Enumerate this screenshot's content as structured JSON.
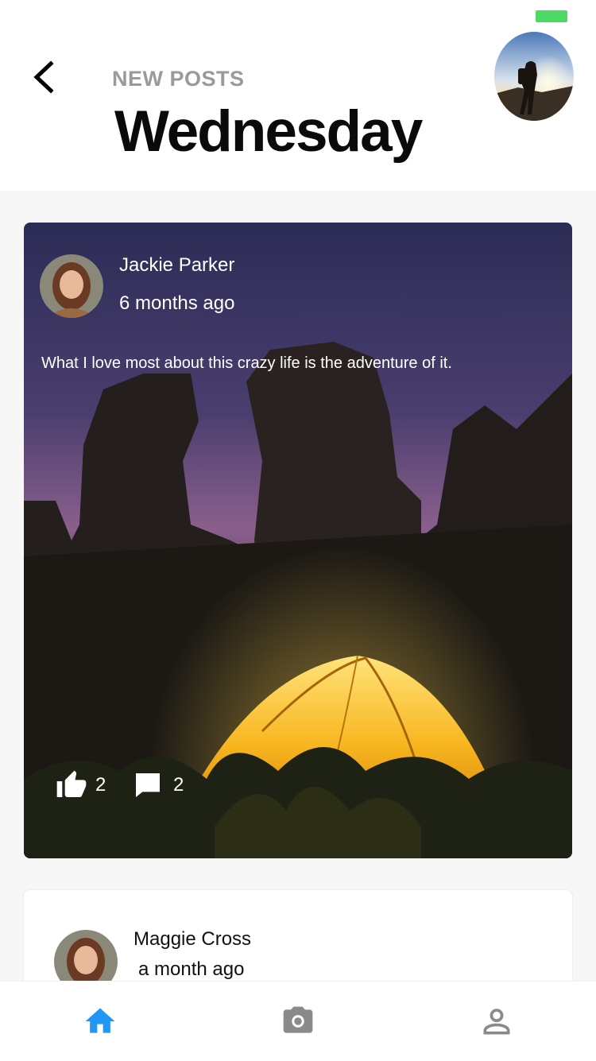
{
  "header": {
    "subtitle": "NEW POSTS",
    "title": "Wednesday",
    "back_icon": "chevron-left-icon",
    "profile_avatar": "profile-photo-hiker"
  },
  "colors": {
    "accent": "#2196f3",
    "inactive_icon": "#8a8a8a",
    "battery": "#4cd964",
    "subtitle": "#9a9a9a"
  },
  "posts": [
    {
      "author": "Jackie Parker",
      "time": "6 months ago",
      "text": "What I love most about this crazy life is the adventure of it.",
      "likes": "2",
      "comments": "2",
      "image": "night-camping-tent-rocks"
    },
    {
      "author": "Maggie Cross",
      "time": "a month ago"
    }
  ],
  "tabbar": {
    "items": [
      {
        "icon": "home-icon",
        "active": true
      },
      {
        "icon": "camera-icon",
        "active": false
      },
      {
        "icon": "person-icon",
        "active": false
      }
    ]
  }
}
